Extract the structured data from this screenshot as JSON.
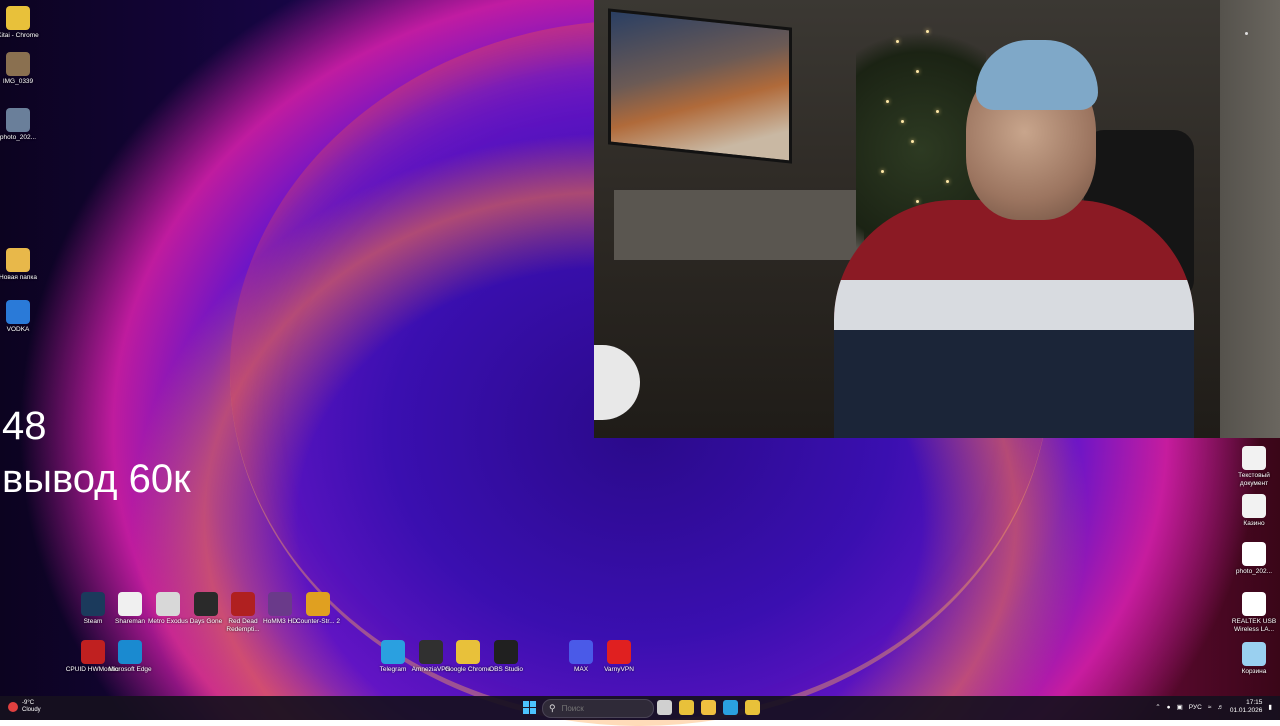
{
  "overlay": {
    "line1": "48",
    "line2": "вывод 60к"
  },
  "desktop_left": [
    {
      "label": "Kitai - Chrome",
      "icon": "chrome-icon",
      "color": "#e8c13a"
    },
    {
      "label": "IMG_0339",
      "icon": "image-file-icon",
      "color": "#8a7050"
    },
    {
      "label": "photo_202...",
      "icon": "image-file-icon",
      "color": "#6a7f9a"
    },
    {
      "label": "Новая папка",
      "icon": "folder-icon",
      "color": "#e8b84a"
    },
    {
      "label": "VODKA",
      "icon": "app-shortcut-icon",
      "color": "#2a7ad8"
    }
  ],
  "desktop_right": [
    {
      "label": "Текстовый документ",
      "icon": "text-document-icon",
      "color": "#f2f2f2"
    },
    {
      "label": "Казино",
      "icon": "text-document-icon",
      "color": "#f2f2f2"
    },
    {
      "label": "photo_202...",
      "icon": "qr-image-icon",
      "color": "#ffffff"
    },
    {
      "label": "REALTEK USB Wireless LA...",
      "icon": "network-adapter-icon",
      "color": "#ffffff"
    },
    {
      "label": "Корзина",
      "icon": "recycle-bin-icon",
      "color": "#9ad0f0"
    }
  ],
  "desktop_games": [
    {
      "label": "Steam",
      "icon": "steam-icon",
      "color": "#1b3a5c"
    },
    {
      "label": "Shareman",
      "icon": "shareman-icon",
      "color": "#f0f0f0"
    },
    {
      "label": "Metro Exodus",
      "icon": "metro-exodus-icon",
      "color": "#d8d8d8"
    },
    {
      "label": "Days Gone",
      "icon": "days-gone-icon",
      "color": "#2a2a2a"
    },
    {
      "label": "Red Dead Redempti...",
      "icon": "red-dead-icon",
      "color": "#b02020"
    },
    {
      "label": "HoMM3 HD",
      "icon": "homm3-icon",
      "color": "#6a3a8a"
    },
    {
      "label": "Counter-Str... 2",
      "icon": "counter-strike-icon",
      "color": "#e0a020"
    }
  ],
  "desktop_row2": [
    {
      "label": "CPUID HWMonitor",
      "icon": "hwmonitor-icon",
      "color": "#c02020"
    },
    {
      "label": "Microsoft Edge",
      "icon": "edge-icon",
      "color": "#1a8ad0"
    }
  ],
  "desktop_center": [
    {
      "label": "Telegram",
      "icon": "telegram-icon",
      "color": "#2aa0e0"
    },
    {
      "label": "AmneziaVPN",
      "icon": "amnezia-vpn-icon",
      "color": "#303030"
    },
    {
      "label": "Google Chrome",
      "icon": "chrome-icon",
      "color": "#e8c13a"
    },
    {
      "label": "OBS Studio",
      "icon": "obs-icon",
      "color": "#202020"
    },
    {
      "label": "MAX",
      "icon": "max-app-icon",
      "color": "#4a5ae8"
    },
    {
      "label": "VarnyVPN",
      "icon": "vpn-b-icon",
      "color": "#e02020"
    }
  ],
  "taskbar": {
    "weather_temp": "-9°C",
    "weather_desc": "Cloudy",
    "search_placeholder": "Поиск",
    "apps": [
      {
        "icon": "task-view-icon",
        "color": "#d0d0d0"
      },
      {
        "icon": "chrome-icon",
        "color": "#e8c13a"
      },
      {
        "icon": "file-explorer-icon",
        "color": "#f0c040"
      },
      {
        "icon": "telegram-icon",
        "color": "#2aa0e0"
      },
      {
        "icon": "chrome-icon",
        "color": "#e8c13a"
      }
    ],
    "language": "РУС",
    "time": "17:15",
    "date": "01.01.2026"
  }
}
